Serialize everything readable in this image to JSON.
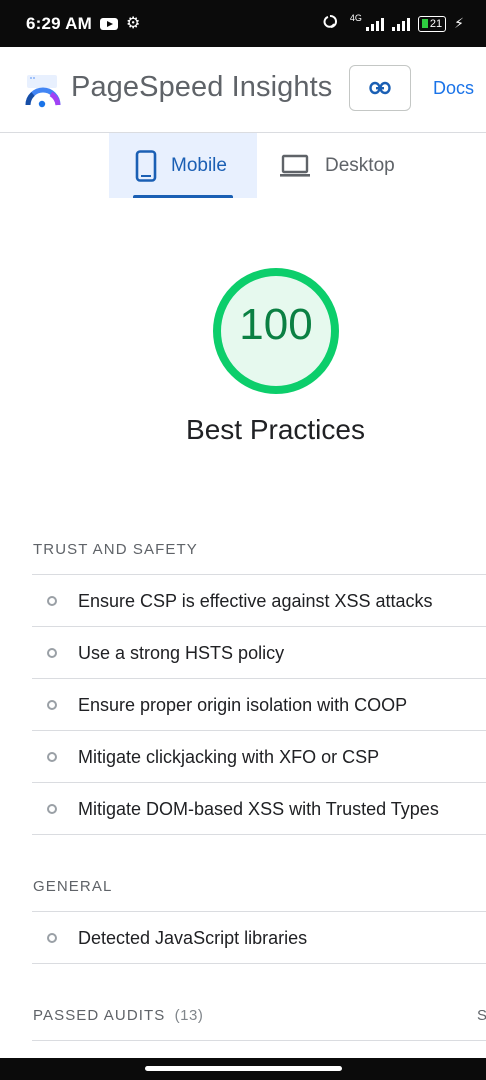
{
  "status_bar": {
    "time": "6:29 AM",
    "network": "4G",
    "battery": "21",
    "icons": [
      "youtube-icon",
      "gear-icon",
      "hotspot-icon",
      "signal-icon",
      "battery-icon",
      "charging-icon"
    ]
  },
  "header": {
    "title": "PageSpeed Insights",
    "docs_label": "Docs",
    "link_icon": "link-icon"
  },
  "tabs": [
    {
      "label": "Mobile",
      "icon": "phone-icon",
      "selected": true
    },
    {
      "label": "Desktop",
      "icon": "laptop-icon",
      "selected": false
    }
  ],
  "score": {
    "value": "100",
    "title": "Best Practices",
    "fraction": 1.0,
    "color": "#0cce6b"
  },
  "sections": {
    "trust": {
      "heading": "TRUST AND SAFETY",
      "items": [
        "Ensure CSP is effective against XSS attacks",
        "Use a strong HSTS policy",
        "Ensure proper origin isolation with COOP",
        "Mitigate clickjacking with XFO or CSP",
        "Mitigate DOM-based XSS with Trusted Types"
      ]
    },
    "general": {
      "heading": "GENERAL",
      "items": [
        "Detected JavaScript libraries"
      ]
    },
    "passed": {
      "heading": "PASSED AUDITS",
      "count": "(13)",
      "right_text": "S"
    }
  },
  "colors": {
    "accent": "#1a73e8",
    "pass_green": "#0cce6b",
    "score_text": "#0b8043",
    "tab_selected_bg": "#e8f0fe"
  }
}
